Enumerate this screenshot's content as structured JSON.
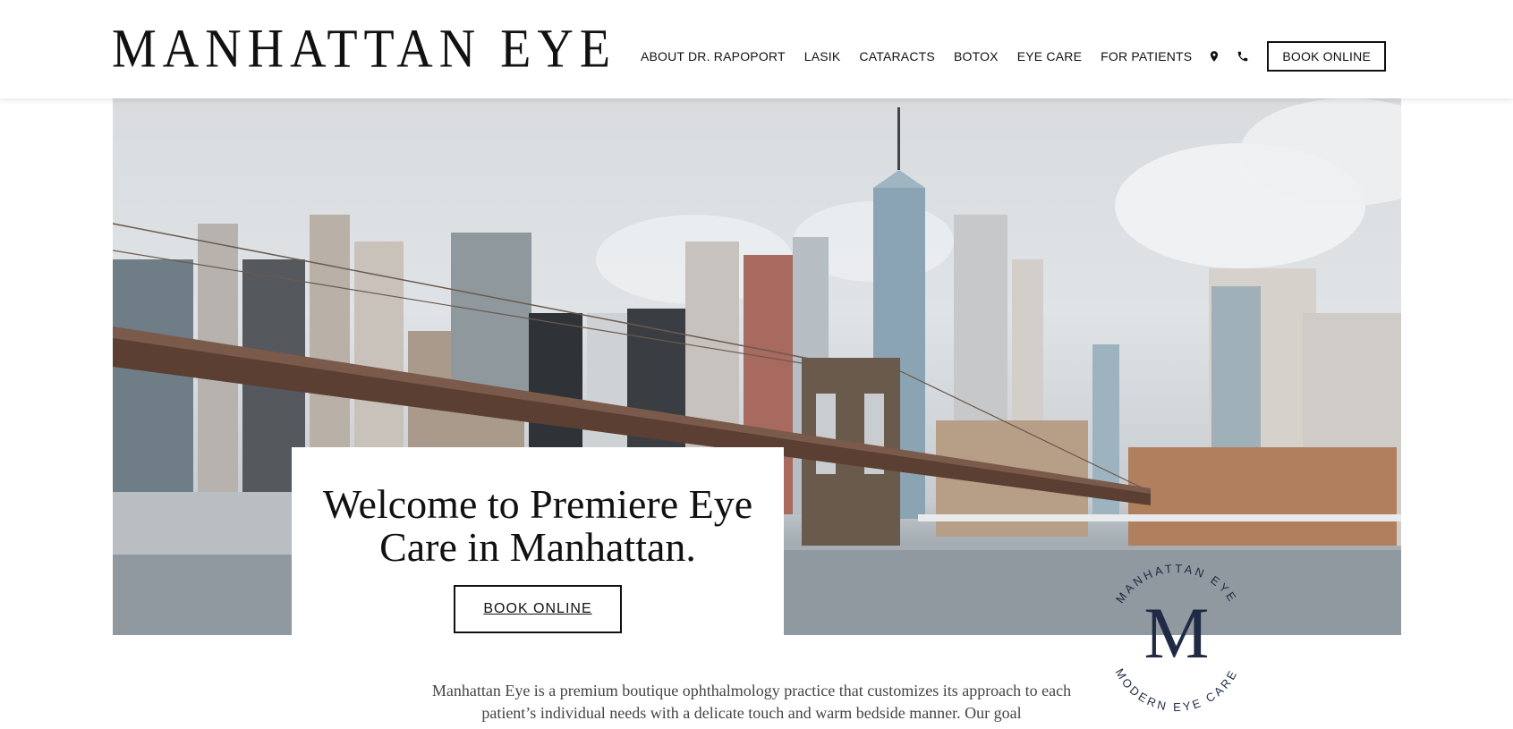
{
  "header": {
    "logo": "MANHATTAN EYE",
    "nav": [
      {
        "label": "ABOUT DR. RAPOPORT"
      },
      {
        "label": "LASIK"
      },
      {
        "label": "CATARACTS"
      },
      {
        "label": "BOTOX"
      },
      {
        "label": "EYE CARE"
      },
      {
        "label": "FOR PATIENTS"
      }
    ],
    "icons": [
      "map-pin-icon",
      "phone-icon"
    ],
    "book_label": "BOOK ONLINE"
  },
  "hero": {
    "title": "Welcome to Premiere Eye Care in Manhattan.",
    "book_label": "BOOK ONLINE"
  },
  "badge": {
    "top_text": "MANHATTAN EYE",
    "monogram": "M",
    "bottom_text": "MODERN EYE CARE"
  },
  "intro": {
    "text": "Manhattan Eye is a premium boutique ophthalmology practice that customizes its approach to each patient’s individual needs with a delicate touch and warm bedside manner. Our goal"
  },
  "colors": {
    "text": "#111111",
    "badge_navy": "#1f2a44",
    "body_text": "#444444"
  }
}
